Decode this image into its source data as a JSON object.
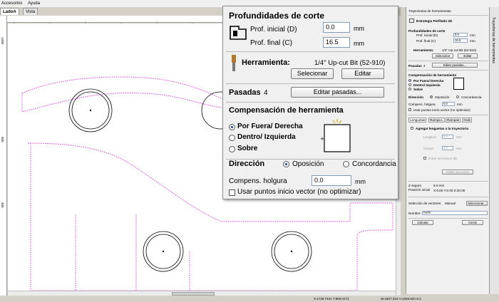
{
  "menu": {
    "accesorios": "Accesorios",
    "ayuda": "Ayuda"
  },
  "tabs": {
    "active": "LadoA",
    "inactive": "Vista 3D"
  },
  "rulers": {
    "top_tick": "0",
    "left_1": "1200",
    "left_2": "600",
    "left_3": "400"
  },
  "zoom": {
    "depths_title": "Profundidades de corte",
    "start_depth_label": "Prof. inicial (D)",
    "start_depth_value": "0.0",
    "start_depth_unit": "mm",
    "final_depth_label": "Prof. final (C)",
    "final_depth_value": "16.5",
    "final_depth_unit": "mm",
    "tool_label": "Herramienta:",
    "tool_name": "1/4\" Up-cut Bit (52-910)",
    "select_button": "Selecionar",
    "edit_button": "Editar",
    "passes_label": "Pasadas",
    "passes_value": "4",
    "edit_passes_button": "Editar pasadas...",
    "comp_title": "Compensación de herramienta",
    "comp_outside": "Por Fuera/ Derecha",
    "comp_inside": "Dentro/ Izquierda",
    "comp_on": "Sobre",
    "direction_label": "Dirección",
    "dir_opposition": "Oposición",
    "dir_climb": "Concordancia",
    "allowance_label": "Compens. holgura",
    "allowance_value": "0.0",
    "allowance_unit": "mm",
    "start_points_label": "Usar puntos inicio vector (no optimizar)"
  },
  "side": {
    "header": "Trayectorias de herramientas",
    "strategy": "Estrategia Perfilado 2D",
    "depths_title": "Profundidades de corte",
    "start_label": "Prof. inicial (D)",
    "start_value": "0.0",
    "final_label": "Prof. final (C)",
    "final_value": "16.5",
    "unit": "mm",
    "tool_label": "Herramienta:",
    "tool_name": "1/4\" Up-cut Bit (52-910)",
    "select_button": "Selecionar",
    "edit_button": "Editar",
    "passes_label": "Pasadas",
    "passes_value": "4",
    "edit_passes_button": "Editar pasadas...",
    "comp_title": "Compensación de herramienta",
    "comp_outside": "Por Fuera/ Derecha",
    "comp_inside": "Dentro/ Izquierda",
    "comp_on": "Sobre",
    "direction_label": "Dirección",
    "dir_opposition": "Oposición",
    "dir_climb": "Concordancia",
    "allowance_label": "Compens. holgura",
    "allowance_value": "0.0",
    "start_points_label": "Usar puntos inicio vector (no optimizar)",
    "tab_lengueta": "Lenguetas",
    "tab_rampa": "Rampa L",
    "tab_rampas": "Rampas",
    "tab_orden": "Orde",
    "add_tabs_label": "Agregar lenguetas a la trayectoria",
    "length_label": "Longitud",
    "length_value": "6.0",
    "thickness_label": "Grosor",
    "thickness_value": "3.0",
    "create_3d_label": "Crear secciones 3D",
    "edit_sections_button": "Editar secciones",
    "safe_z_label": "Z seguro",
    "safe_z_value": "6.0 mm",
    "home_label": "Posición inicial",
    "home_value": "X:0.00 Y:0.00 Z:20.00",
    "vector_sel_label": "Selección de vectores:",
    "vector_sel_value": "Manual",
    "select_vec_button": "Seleccionar...",
    "name_label": "Nombre:",
    "name_value": "Perfil",
    "calc_button": "Calcular",
    "close_button": "Cerrar",
    "side_tab": "Trayectorias de herramientas"
  },
  "status": {
    "coords": "X:1729.7431 Y:809.0173",
    "size": "W:1807.334  H:1009.820  S:2"
  },
  "colors": {
    "toolpath": "#e040e0",
    "panel": "#f0f0f0",
    "accent": "#1a3ba8"
  }
}
